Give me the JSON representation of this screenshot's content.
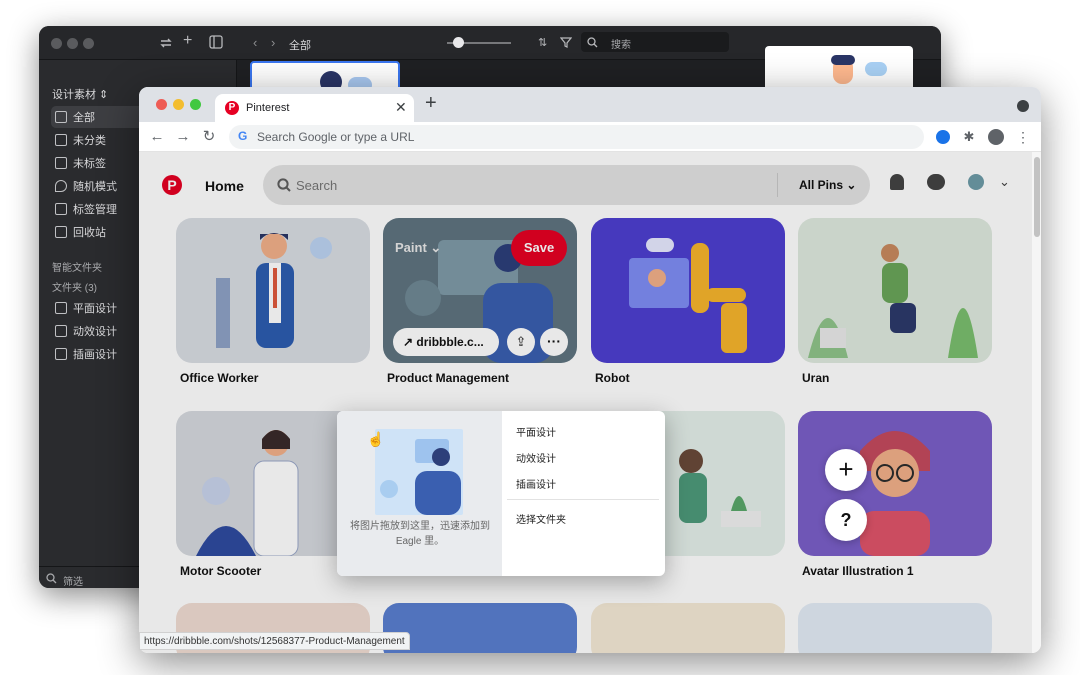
{
  "eagle": {
    "breadcrumb": "全部",
    "search_placeholder": "搜索",
    "library_title": "设计素材",
    "nav": [
      {
        "label": "全部",
        "icon": "inbox-icon"
      },
      {
        "label": "未分类",
        "icon": "unfiled-icon"
      },
      {
        "label": "未标签",
        "icon": "untagged-icon"
      },
      {
        "label": "随机模式",
        "icon": "location-pin-icon"
      },
      {
        "label": "标签管理",
        "icon": "tag-manager-icon"
      },
      {
        "label": "回收站",
        "icon": "trash-icon"
      }
    ],
    "smart_folders_label": "智能文件夹",
    "folders_label": "文件夹 (3)",
    "folders": [
      "平面设计",
      "动效设计",
      "插画设计"
    ],
    "filter_label": "筛选"
  },
  "chrome": {
    "tab_title": "Pinterest",
    "omnibox_placeholder": "Search Google or type a URL",
    "status_url": "https://dribbble.com/shots/12568377-Product-Management"
  },
  "pinterest": {
    "home_label": "Home",
    "search_placeholder": "Search",
    "filter_label": "All Pins",
    "row1": [
      {
        "title": "Office Worker",
        "bg": "#d9dde3"
      },
      {
        "title": "Product Management",
        "bg": "#5f7480",
        "board": "Paint",
        "save": "Save",
        "link": "dribbble.c..."
      },
      {
        "title": "Robot",
        "bg": "#4e3fd0"
      },
      {
        "title": "Uran",
        "bg": "#dfe9df"
      }
    ],
    "row2": [
      {
        "title": "Motor Scooter",
        "bg": "#d6d9de"
      },
      {
        "title": "",
        "bg": "#e4efe9"
      },
      {
        "title": "Avatar Illustration 1",
        "bg": "#7a5fc9"
      }
    ],
    "fab_plus": "+",
    "fab_help": "?"
  },
  "drop_overlay": {
    "hint": "将图片拖放到这里，迅速添加到 Eagle 里。",
    "folders": [
      "平面设计",
      "动效设计",
      "插画设计"
    ],
    "choose_folder": "选择文件夹"
  },
  "colors": {
    "pinterest_red": "#e60023",
    "eagle_bg": "#1f2023",
    "chrome_tabstrip": "#dee1e6"
  }
}
